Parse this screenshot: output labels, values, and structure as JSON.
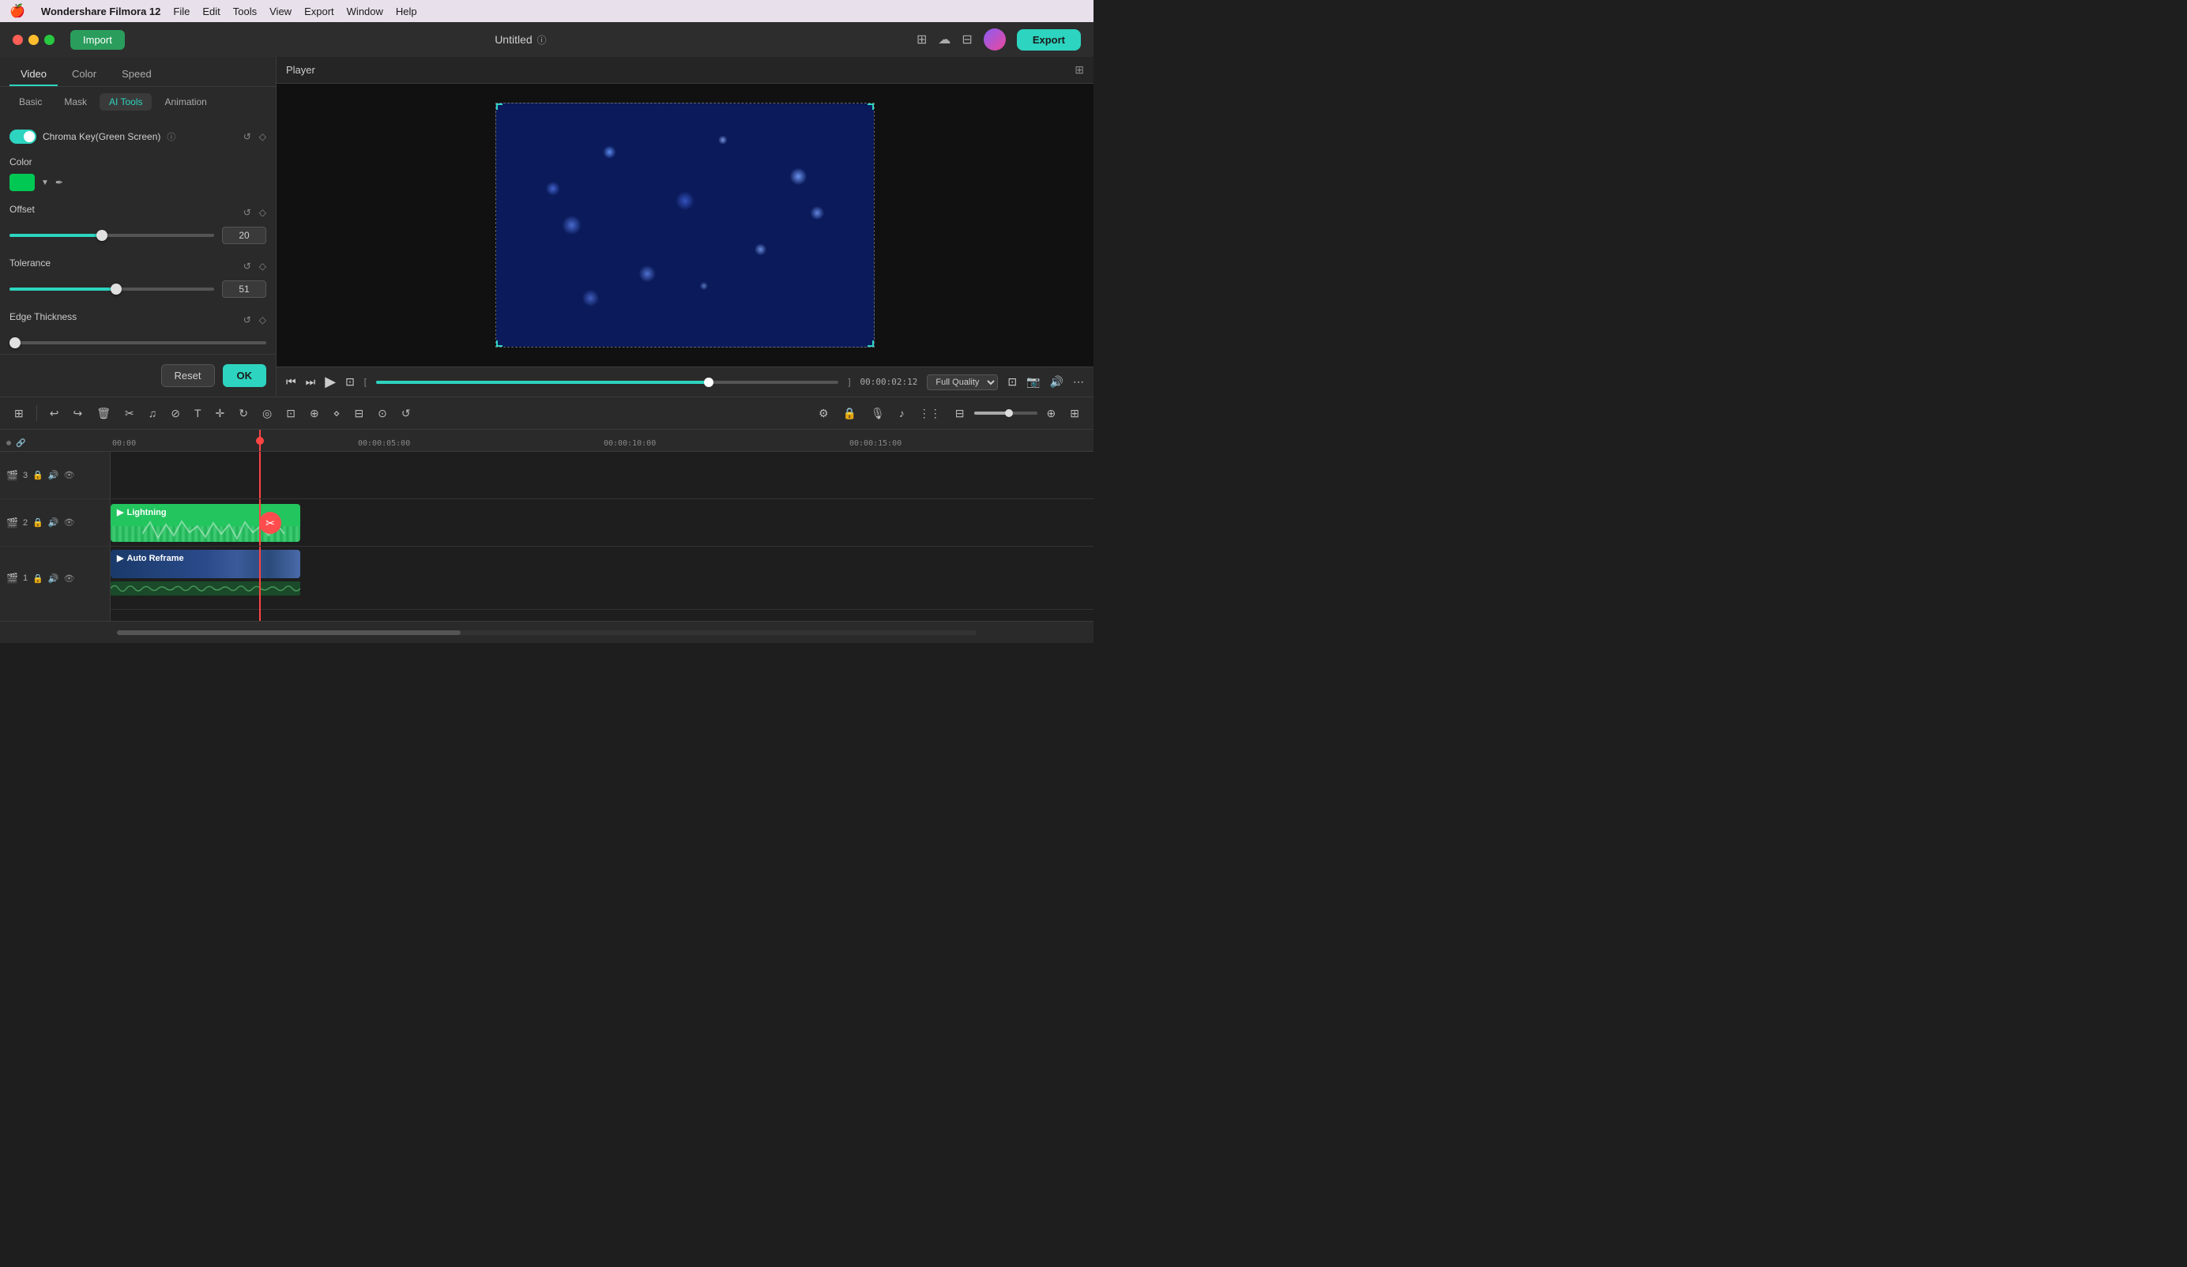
{
  "menubar": {
    "apple": "🍎",
    "app_name": "Wondershare Filmora 12",
    "items": [
      "File",
      "Edit",
      "Tools",
      "View",
      "Export",
      "Window",
      "Help"
    ]
  },
  "titlebar": {
    "import_label": "Import",
    "title": "Untitled",
    "export_label": "Export"
  },
  "left_panel": {
    "tabs": [
      "Video",
      "Color",
      "Speed"
    ],
    "active_tab": "Video",
    "sub_tabs": [
      "Basic",
      "Mask",
      "AI Tools",
      "Animation"
    ],
    "active_sub_tab": "AI Tools",
    "chroma_key": {
      "label": "Chroma Key(Green Screen)",
      "enabled": true
    },
    "color_section": {
      "label": "Color"
    },
    "offset": {
      "label": "Offset",
      "value": "20",
      "percent": 45
    },
    "tolerance": {
      "label": "Tolerance",
      "value": "51",
      "percent": 52
    },
    "edge_thickness": {
      "label": "Edge Thickness"
    },
    "reset_label": "Reset",
    "ok_label": "OK"
  },
  "player": {
    "label": "Player",
    "timecode": "00:00:02:12",
    "quality": "Full Quality",
    "progress_percent": 72
  },
  "toolbar": {
    "tools": [
      "⊞",
      "↩",
      "↪",
      "🗑",
      "✂",
      "♫",
      "⊘",
      "T",
      "✛",
      "↻",
      "◎",
      "⊡",
      "⊕",
      "⋄",
      "⊟",
      "⊙",
      "↺"
    ],
    "right_tools": [
      "⚙",
      "🔒",
      "🎙",
      "♪",
      "⋮",
      "⊞",
      "⊟"
    ]
  },
  "timeline": {
    "ruler_marks": [
      "00:00",
      "00:00:05:00",
      "00:00:10:00",
      "00:00:15:00"
    ],
    "tracks": [
      {
        "id": "v3",
        "icon": "🎬",
        "num": "3",
        "type": "video"
      },
      {
        "id": "v2",
        "icon": "🎬",
        "num": "2",
        "type": "video",
        "clip_name": "Lightning",
        "clip_color": "green"
      },
      {
        "id": "v1",
        "icon": "🎬",
        "num": "1",
        "type": "video",
        "clip_name": "Auto Reframe",
        "clip_color": "blue"
      },
      {
        "id": "a1",
        "icon": "♪",
        "num": "1",
        "type": "audio"
      }
    ]
  }
}
